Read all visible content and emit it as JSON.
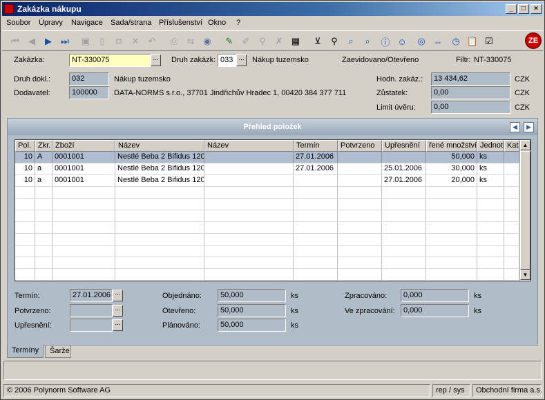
{
  "window": {
    "title": "Zakázka nákupu",
    "min": "_",
    "max": "□",
    "close": "×"
  },
  "menu": [
    "Soubor",
    "Úpravy",
    "Navigace",
    "Sada/strana",
    "Příslušenství",
    "Okno",
    "?"
  ],
  "toolbar": {
    "logo": "ZE"
  },
  "header": {
    "zakazka_label": "Zakázka:",
    "zakazka_value": "NT-330075",
    "druh_zakazky_label": "Druh zakázk:",
    "druh_zakazky_value": "033",
    "druh_zakazky_text": "Nákup tuzemsko",
    "state": "Zaevidovano/Otevřeno",
    "filter_label": "Filtr:",
    "filter_value": "NT-330075",
    "druh_dokl_label": "Druh dokl.:",
    "druh_dokl_value": "032",
    "druh_dokl_text": "Nákup tuzemsko",
    "dodavatel_label": "Dodavatel:",
    "dodavatel_value": "100000",
    "dodavatel_text": "DATA-NORMS s.r.o., 37701 Jindřichův Hradec 1, 00420 384 377 711",
    "hodn_label": "Hodn. zakáz.:",
    "hodn_value": "13 434,62",
    "hodn_cur": "CZK",
    "zustatek_label": "Zůstatek:",
    "zustatek_value": "0,00",
    "zustatek_cur": "CZK",
    "limit_label": "Limit úvěru:",
    "limit_value": "0,00",
    "limit_cur": "CZK"
  },
  "panel": {
    "title": "Přehled položek",
    "prev": "◀",
    "next": "▶"
  },
  "grid": {
    "columns": [
      "Pol.",
      "Zkr.",
      "Zboží",
      "Název",
      "Název",
      "Termín",
      "Potvrzeno",
      "Upřesnění",
      "řené množství",
      "Jednotk",
      "Kat."
    ],
    "rows": [
      [
        "10",
        "A",
        "0001001",
        "Nestlé Beba 2 Bifidus 1200",
        "",
        "27.01.2006",
        "",
        "",
        "50,000",
        "ks",
        ""
      ],
      [
        "10",
        "a",
        "0001001",
        "Nestlé Beba 2 Bifidus 1200",
        "",
        "27.01.2006",
        "",
        "25.01.2006",
        "30,000",
        "ks",
        ""
      ],
      [
        "10",
        "a",
        "0001001",
        "Nestlé Beba 2 Bifidus 1200",
        "",
        "",
        "",
        "27.01.2006",
        "20,000",
        "ks",
        ""
      ]
    ]
  },
  "details": {
    "termin_label": "Termín:",
    "termin_value": "27.01.2006",
    "potvrzeno_label": "Potvrzeno:",
    "potvrzeno_value": "",
    "upresneni_label": "Upřesnění:",
    "upresneni_value": "",
    "objednano_label": "Objednáno:",
    "objednano_value": "50,000",
    "objednano_unit": "ks",
    "otevreno_label": "Otevřeno:",
    "otevreno_value": "50,000",
    "otevreno_unit": "ks",
    "planovano_label": "Plánováno:",
    "planovano_value": "50,000",
    "planovano_unit": "ks",
    "zpracovano_label": "Zpracováno:",
    "zpracovano_value": "0,000",
    "zpracovano_unit": "ks",
    "ve_zprac_label": "Ve zpracování:",
    "ve_zprac_value": "0,000",
    "ve_zprac_unit": "ks"
  },
  "tabs": [
    "Termíny",
    "Šarže"
  ],
  "status": {
    "copyright": "© 2006 Polynorm Software AG",
    "user": "rep / sys",
    "company": "Obchodní firma a.s."
  }
}
